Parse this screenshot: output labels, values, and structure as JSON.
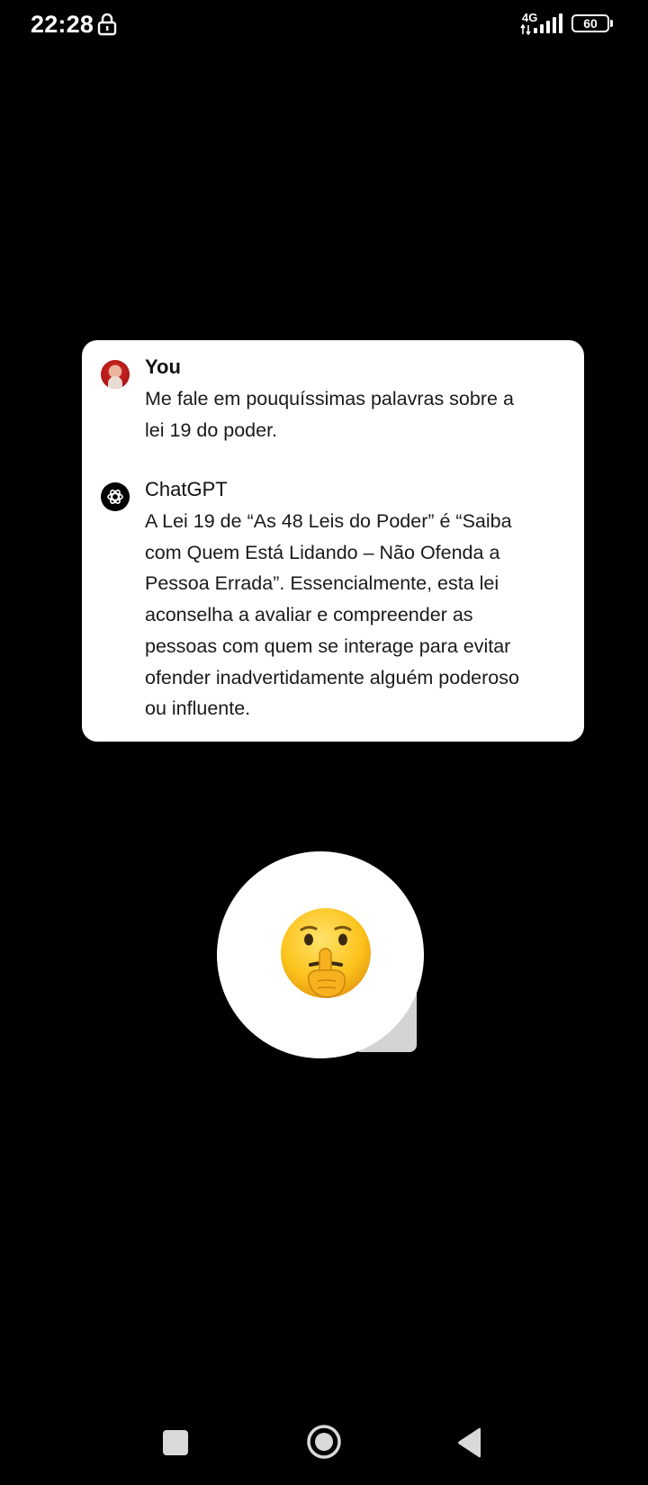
{
  "status_bar": {
    "time": "22:28",
    "network": "4G",
    "battery": "60"
  },
  "chat": {
    "messages": [
      {
        "author": "You",
        "lines": [
          "Me fale em pouquíssimas palavras sobre a",
          "lei 19 do poder."
        ]
      },
      {
        "author": "ChatGPT",
        "lines": [
          "A Lei 19 de “As 48 Leis do Poder” é “Saiba",
          "com Quem Está Lidando – Não Ofenda a",
          "Pessoa Errada”. Essencialmente, esta lei",
          "aconselha a avaliar e compreender as",
          "pessoas com quem se interage para evitar",
          "ofender inadvertidamente alguém poderoso",
          "ou influente."
        ]
      }
    ]
  },
  "reaction": {
    "emoji_name": "shushing-face-emoji"
  },
  "nav_bar": {
    "recents_icon": "square-icon",
    "home_icon": "circle-icon",
    "back_icon": "triangle-back-icon"
  },
  "colors": {
    "background": "#000000",
    "card": "#ffffff",
    "text": "#1a1a1a",
    "emoji_yellow": "#fcc21b"
  }
}
